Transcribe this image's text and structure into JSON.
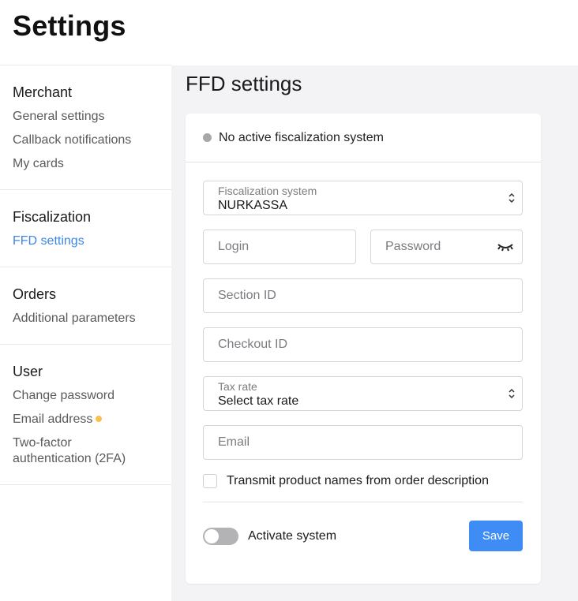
{
  "header": {
    "title": "Settings"
  },
  "sidebar": {
    "sections": [
      {
        "heading": "Merchant",
        "items": [
          "General settings",
          "Callback notifications",
          "My cards"
        ]
      },
      {
        "heading": "Fiscalization",
        "items": [
          "FFD settings"
        ]
      },
      {
        "heading": "Orders",
        "items": [
          "Additional parameters"
        ]
      },
      {
        "heading": "User",
        "items": [
          "Change password",
          "Email address",
          "Two-factor authentication (2FA)"
        ]
      }
    ],
    "active_item": "FFD settings",
    "badge_color": "#f7c14a"
  },
  "main": {
    "title": "FFD settings",
    "status": {
      "text": "No active fiscalization system",
      "dot_color": "#a7a7a7"
    },
    "fiscal_system": {
      "label": "Fiscalization system",
      "value": "NURKASSA"
    },
    "login": {
      "placeholder": "Login"
    },
    "password": {
      "placeholder": "Password"
    },
    "section_id": {
      "placeholder": "Section ID"
    },
    "checkout_id": {
      "placeholder": "Checkout ID"
    },
    "tax_rate": {
      "label": "Tax rate",
      "value": "Select tax rate"
    },
    "email": {
      "placeholder": "Email"
    },
    "transmit_checkbox": {
      "label": "Transmit product names from order description",
      "checked": false
    },
    "activate_toggle": {
      "label": "Activate system",
      "on": false
    },
    "save_label": "Save"
  },
  "colors": {
    "accent": "#3f8cf5",
    "active_link": "#3d86e6",
    "background": "#f3f3f5"
  }
}
